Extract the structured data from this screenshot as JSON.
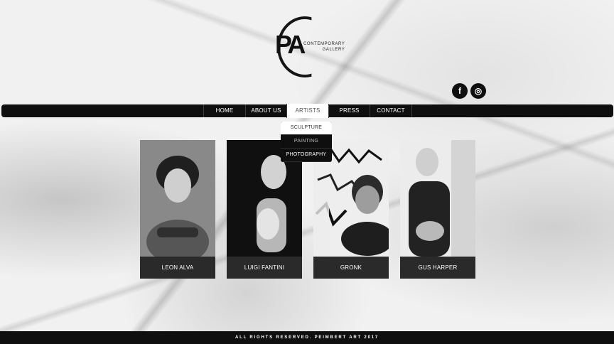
{
  "logo": {
    "mark": "PA",
    "line1": "CONTEMPORARY",
    "line2": "GALLERY"
  },
  "social": {
    "facebook": "f",
    "instagram": "◎"
  },
  "nav": {
    "items": [
      "HOME",
      "ABOUT US",
      "ARTISTS",
      "PRESS",
      "CONTACT"
    ],
    "active": "ARTISTS"
  },
  "dropdown": {
    "items": [
      "SCULPTURE",
      "PAINTING",
      "PHOTOGRAPHY"
    ]
  },
  "artists": [
    "LEON ALVA",
    "LUIGI FANTINI",
    "GRONK",
    "GUS HARPER"
  ],
  "footer": {
    "copyright": "ALL RIGHTS RESERVED. PEIMBERT ART 2017"
  }
}
